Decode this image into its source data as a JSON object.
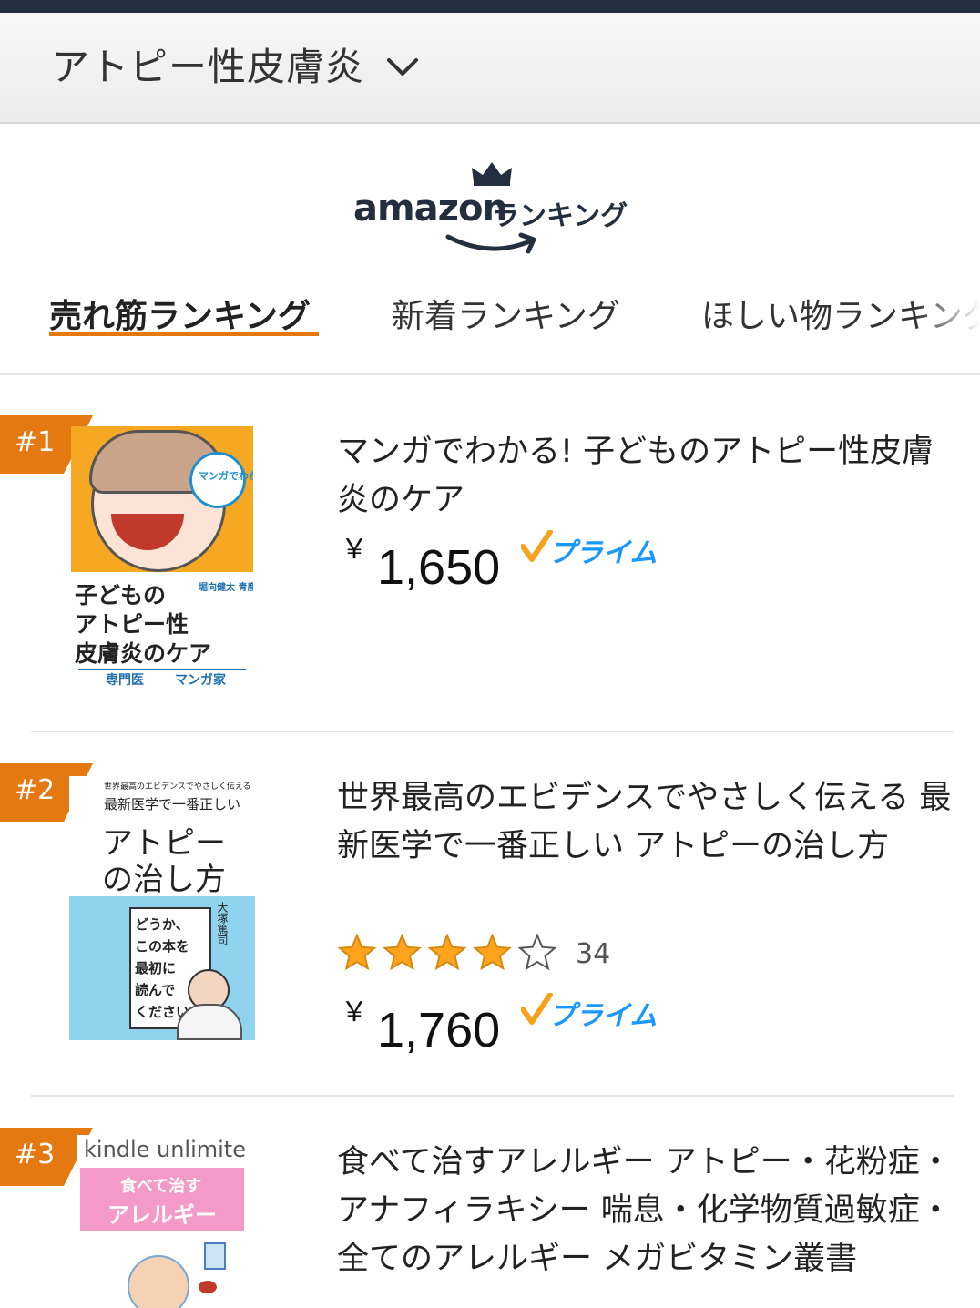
{
  "category": {
    "title": "アトピー性皮膚炎",
    "chevron_icon": "chevron-down-icon"
  },
  "logo": {
    "brand": "amazon",
    "ranking_label": "ランキング"
  },
  "tabs": [
    {
      "label": "売れ筋ランキング",
      "active": true
    },
    {
      "label": "新着ランキング",
      "active": false
    },
    {
      "label": "ほしい物ランキング",
      "active": false
    }
  ],
  "colors": {
    "accent": "#e47911",
    "prime": "#1a98ff",
    "check": "#f7a21b",
    "star": "#ffa41c",
    "header": "#232f3e"
  },
  "items": [
    {
      "rank": "#1",
      "title": "マンガでわかる! 子どものアトピー性皮膚炎のケア",
      "currency": "￥",
      "price": "1,650",
      "prime": "プライム",
      "cover": {
        "bubble": "マンガでわかる!",
        "title_lines": [
          "子どもの",
          "アトピー性",
          "皮膚炎のケア"
        ],
        "authors": "堀向健太 青鹿ユウ",
        "footer_left": "専門医",
        "footer_right": "マンガ家"
      }
    },
    {
      "rank": "#2",
      "title": "世界最高のエビデンスでやさしく伝える 最新医学で一番正しい アトピーの治し方",
      "rating": 4,
      "review_count": "34",
      "currency": "￥",
      "price": "1,760",
      "prime": "プライム",
      "cover": {
        "top_small": "世界最高のエビデンスでやさしく伝える",
        "top_line": "最新医学で一番正しい",
        "title_lines": [
          "アトピー",
          "の治し方"
        ],
        "box_lines": [
          "どうか、",
          "この本を",
          "最初に",
          "読んで",
          "ください。"
        ],
        "author": "大塚篤司"
      }
    },
    {
      "rank": "#3",
      "title": "食べて治すアレルギー アトピー・花粉症・アナフィラキシー 喘息・化学物質過敏症・全てのアレルギー メガビタミン叢書",
      "cover": {
        "brand_left": "kindle",
        "brand_right": "unlimited",
        "title_top": "食べて治す",
        "title_main": "アレルギー"
      }
    }
  ]
}
